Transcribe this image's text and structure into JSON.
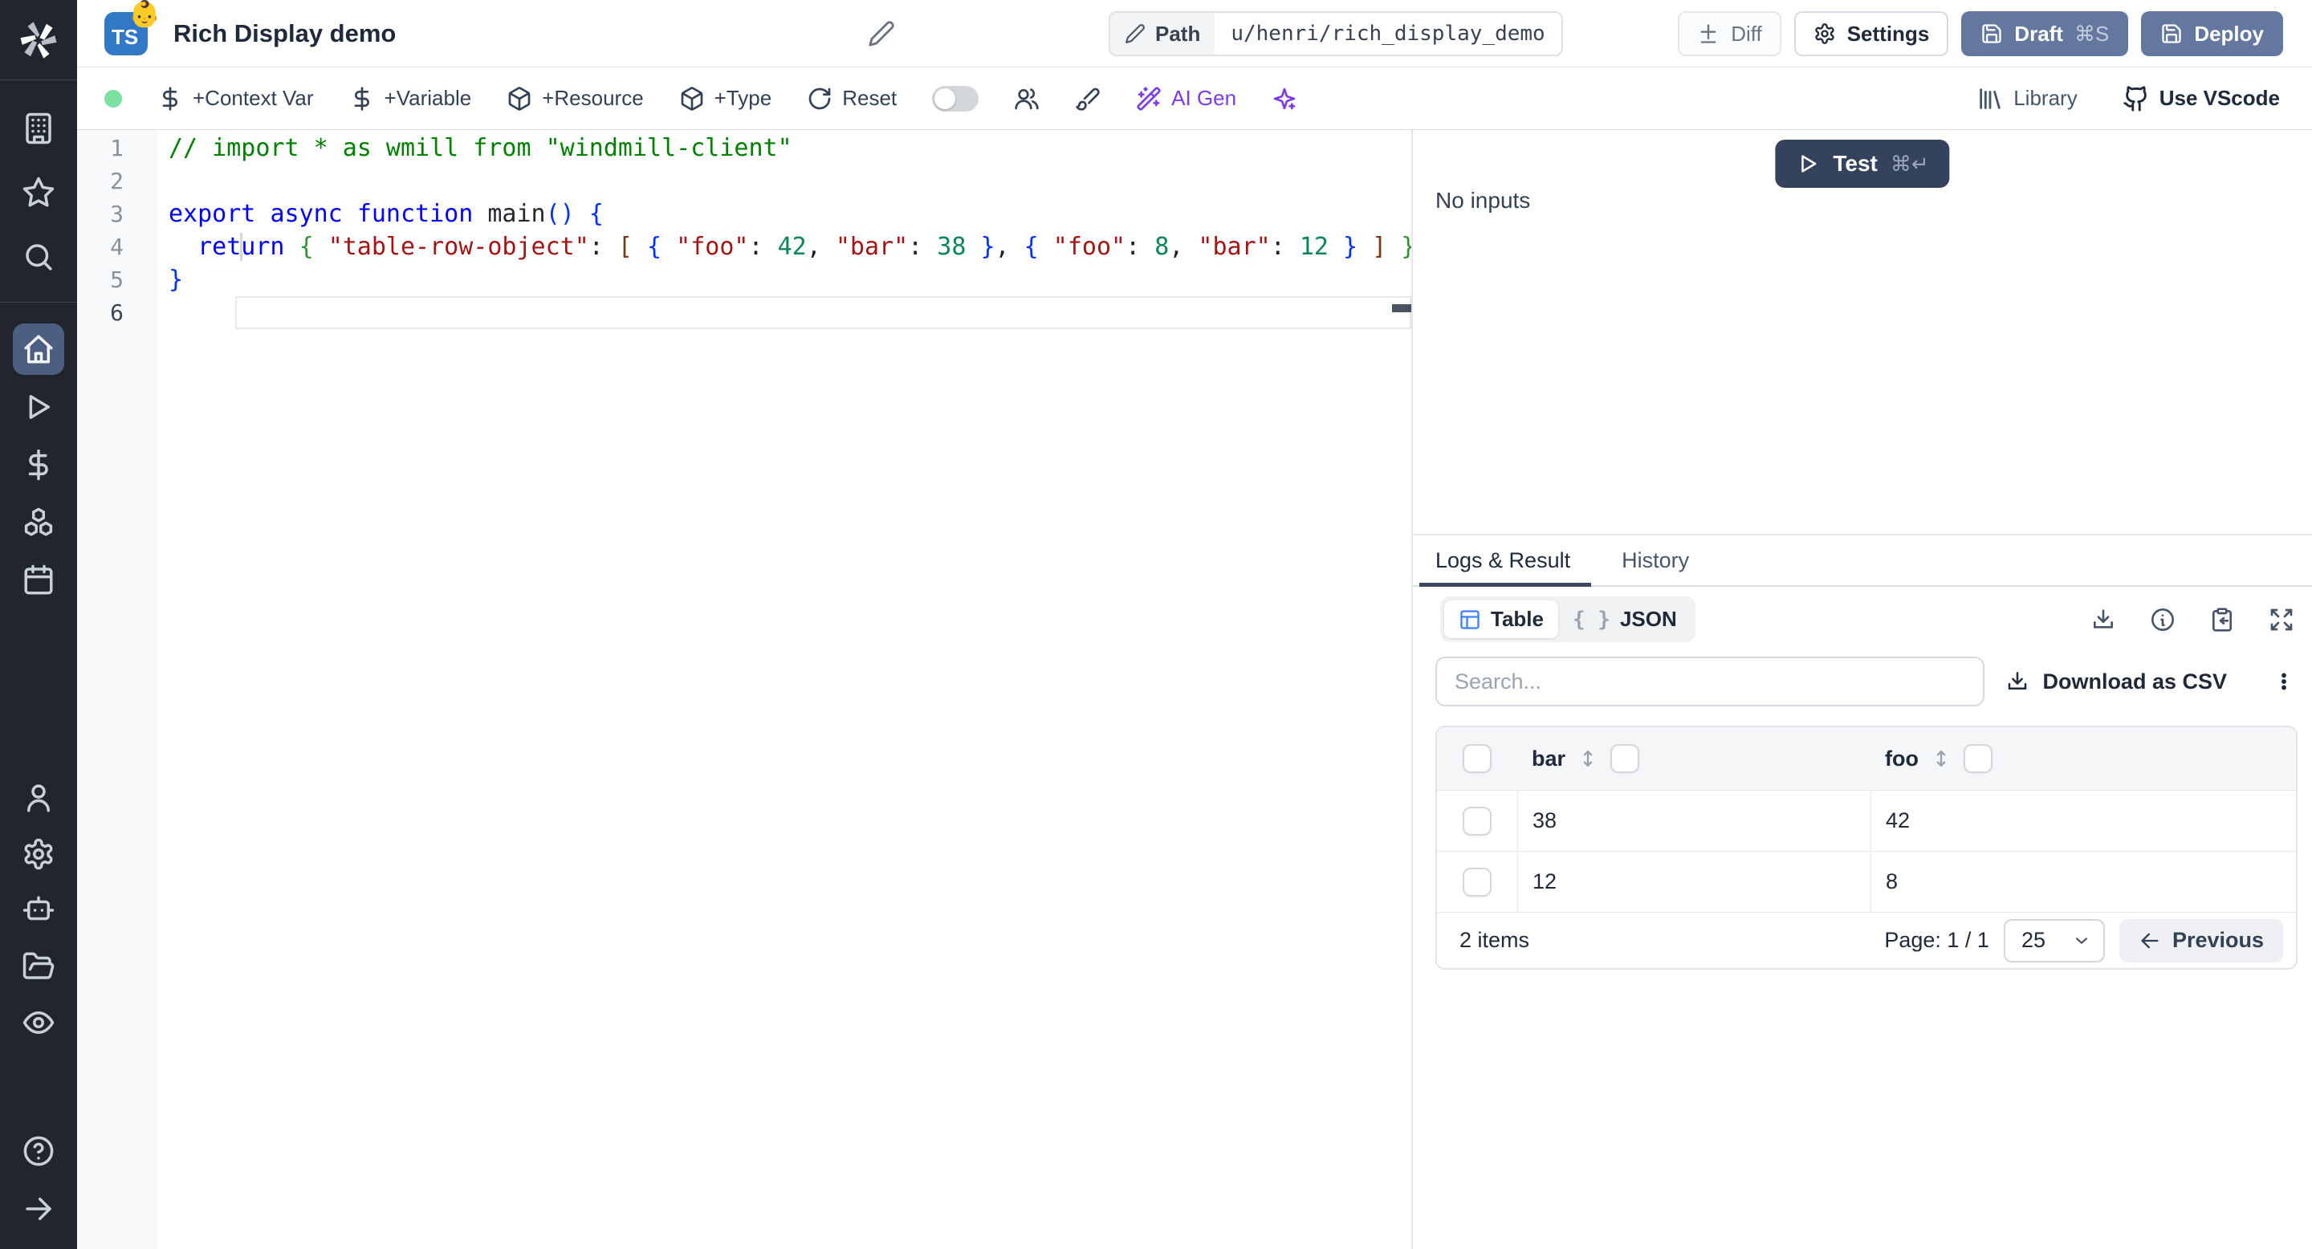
{
  "colors": {
    "sidebar_bg": "#21262e",
    "active_item_bg": "#4c5f80",
    "slate_button": "#64789f",
    "test_button": "#35425c",
    "ai_accent": "#7c3aed",
    "ts_badge": "#3178c6",
    "status_dot": "#7ce0a3",
    "table_icon": "#3b82f6",
    "tab_underline": "#3d4a5f"
  },
  "sidebar": {
    "groups": [
      {
        "id": "top",
        "items": [
          {
            "name": "workspace",
            "icon": "building"
          },
          {
            "name": "favorites",
            "icon": "star"
          },
          {
            "name": "search",
            "icon": "search"
          }
        ]
      },
      {
        "id": "main",
        "items": [
          {
            "name": "home",
            "icon": "home",
            "active": true
          },
          {
            "name": "runs",
            "icon": "play"
          },
          {
            "name": "variables",
            "icon": "dollar"
          },
          {
            "name": "resources",
            "icon": "boxes"
          },
          {
            "name": "schedules",
            "icon": "calendar"
          }
        ]
      },
      {
        "id": "bottom",
        "items": [
          {
            "name": "user",
            "icon": "user"
          },
          {
            "name": "settings",
            "icon": "gear"
          },
          {
            "name": "workers",
            "icon": "bot"
          },
          {
            "name": "folders",
            "icon": "folder"
          },
          {
            "name": "audit-logs",
            "icon": "eye"
          }
        ]
      },
      {
        "id": "footer",
        "items": [
          {
            "name": "help",
            "icon": "help"
          },
          {
            "name": "expand",
            "icon": "arrow-right"
          }
        ]
      }
    ]
  },
  "header": {
    "language_badge": "TS",
    "emoji": "👶",
    "title": "Rich Display demo",
    "path_label": "Path",
    "path_value": "u/henri/rich_display_demo",
    "diff_label": "Diff",
    "settings_label": "Settings",
    "draft_label": "Draft",
    "draft_shortcut": "⌘S",
    "deploy_label": "Deploy"
  },
  "toolbar": {
    "items": [
      {
        "type": "dot",
        "name": "status-dot"
      },
      {
        "type": "button",
        "name": "add-context-var",
        "icon": "dollar",
        "label": "+Context Var"
      },
      {
        "type": "button",
        "name": "add-variable",
        "icon": "dollar",
        "label": "+Variable"
      },
      {
        "type": "button",
        "name": "add-resource",
        "icon": "package",
        "label": "+Resource"
      },
      {
        "type": "button",
        "name": "add-type",
        "icon": "package",
        "label": "+Type"
      },
      {
        "type": "button",
        "name": "reset",
        "icon": "rotate",
        "label": "Reset"
      },
      {
        "type": "toggle",
        "name": "multiplayer-toggle"
      },
      {
        "type": "icon",
        "name": "multiplayer",
        "icon": "users"
      },
      {
        "type": "icon",
        "name": "format-code",
        "icon": "brush"
      },
      {
        "type": "button",
        "name": "ai-gen",
        "icon": "wand",
        "label": "AI Gen",
        "accent": true
      },
      {
        "type": "icon",
        "name": "ai-sparkles",
        "icon": "sparkles",
        "accent": true
      }
    ],
    "library_label": "Library",
    "vscode_label": "Use VScode"
  },
  "editor": {
    "lines": [
      {
        "n": "1",
        "tokens": [
          [
            "// import * as wmill from \"windmill-client\"",
            "cmt"
          ]
        ]
      },
      {
        "n": "2",
        "tokens": []
      },
      {
        "n": "3",
        "tokens": [
          [
            "export",
            "kw"
          ],
          [
            " ",
            "pl"
          ],
          [
            "async",
            "kw"
          ],
          [
            " ",
            "pl"
          ],
          [
            "function",
            "kw"
          ],
          [
            " ",
            "pl"
          ],
          [
            "main",
            "fn"
          ],
          [
            "(",
            "b1"
          ],
          [
            ")",
            "b1"
          ],
          [
            " ",
            "pl"
          ],
          [
            "{",
            "b1"
          ]
        ]
      },
      {
        "n": "4",
        "caret": true,
        "tokens": [
          [
            "  ",
            "pl"
          ],
          [
            "return",
            "kw"
          ],
          [
            " ",
            "pl"
          ],
          [
            "{",
            "b2"
          ],
          [
            " ",
            "pl"
          ],
          [
            "\"table-row-object\"",
            "str"
          ],
          [
            ":",
            "pl"
          ],
          [
            " ",
            "pl"
          ],
          [
            "[",
            "b3"
          ],
          [
            " ",
            "pl"
          ],
          [
            "{",
            "b1"
          ],
          [
            " ",
            "pl"
          ],
          [
            "\"foo\"",
            "str"
          ],
          [
            ":",
            "pl"
          ],
          [
            " ",
            "pl"
          ],
          [
            "42",
            "num"
          ],
          [
            ",",
            "pl"
          ],
          [
            " ",
            "pl"
          ],
          [
            "\"bar\"",
            "str"
          ],
          [
            ":",
            "pl"
          ],
          [
            " ",
            "pl"
          ],
          [
            "38",
            "num"
          ],
          [
            " ",
            "pl"
          ],
          [
            "}",
            "b1"
          ],
          [
            ",",
            "pl"
          ],
          [
            " ",
            "pl"
          ],
          [
            "{",
            "b1"
          ],
          [
            " ",
            "pl"
          ],
          [
            "\"foo\"",
            "str"
          ],
          [
            ":",
            "pl"
          ],
          [
            " ",
            "pl"
          ],
          [
            "8",
            "num"
          ],
          [
            ",",
            "pl"
          ],
          [
            " ",
            "pl"
          ],
          [
            "\"bar\"",
            "str"
          ],
          [
            ":",
            "pl"
          ],
          [
            " ",
            "pl"
          ],
          [
            "12",
            "num"
          ],
          [
            " ",
            "pl"
          ],
          [
            "}",
            "b1"
          ],
          [
            " ",
            "pl"
          ],
          [
            "]",
            "b3"
          ],
          [
            " ",
            "pl"
          ],
          [
            "}",
            "b2"
          ]
        ]
      },
      {
        "n": "5",
        "tokens": [
          [
            "}",
            "b1"
          ]
        ]
      },
      {
        "n": "6",
        "current": true,
        "tokens": []
      }
    ]
  },
  "run_panel": {
    "test_label": "Test",
    "test_shortcut": "⌘↵",
    "no_inputs": "No inputs"
  },
  "result_panel": {
    "tabs": [
      {
        "label": "Logs & Result",
        "active": true
      },
      {
        "label": "History",
        "active": false
      }
    ],
    "view_toggle": {
      "table_label": "Table",
      "json_label": "JSON",
      "braces_glyph": "{ }"
    },
    "search_placeholder": "Search...",
    "download_csv_label": "Download as CSV",
    "table": {
      "columns": [
        "bar",
        "foo"
      ],
      "rows": [
        [
          "38",
          "42"
        ],
        [
          "12",
          "8"
        ]
      ],
      "items_text": "2 items",
      "page_text": "Page: 1 / 1",
      "page_size": "25",
      "previous_label": "Previous"
    }
  }
}
